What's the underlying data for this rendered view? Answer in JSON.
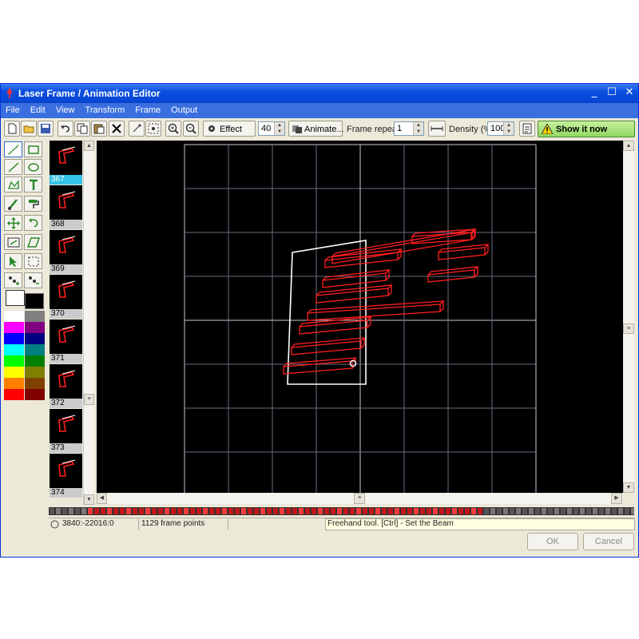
{
  "window": {
    "title": "Laser Frame / Animation Editor",
    "controls": [
      "_",
      "☐",
      "✕"
    ]
  },
  "menu": [
    "File",
    "Edit",
    "View",
    "Transform",
    "Frame",
    "Output"
  ],
  "toolbar": {
    "effect_label": "Effect",
    "effect_value": "40",
    "animate_label": "Animate...",
    "frame_repeats_label": "Frame repeats",
    "frame_repeats_value": "1",
    "density_label": "Density (%)",
    "density_value": "100",
    "show_now_label": "Show it now"
  },
  "frames": [
    {
      "number": "367",
      "selected": true
    },
    {
      "number": "368",
      "selected": false
    },
    {
      "number": "369",
      "selected": false
    },
    {
      "number": "370",
      "selected": false
    },
    {
      "number": "371",
      "selected": false
    },
    {
      "number": "372",
      "selected": false
    },
    {
      "number": "373",
      "selected": false
    },
    {
      "number": "374",
      "selected": false
    }
  ],
  "palette": [
    "#ffffff",
    "#808080",
    "#ff00ff",
    "#800080",
    "#0000ff",
    "#000080",
    "#00ffff",
    "#008080",
    "#00ff00",
    "#008000",
    "#ffff00",
    "#808000",
    "#ff8000",
    "#804000",
    "#ff0000",
    "#800000"
  ],
  "status": {
    "coords": "3840:-22016:0",
    "points": "1129 frame points",
    "hint": "Freehand tool. [Ctrl] - Set the Beam"
  },
  "buttons": {
    "ok": "OK",
    "cancel": "Cancel"
  },
  "colors": {
    "beam": "#ff1e1e",
    "outline": "#ffffff",
    "grid": "#6d6d85",
    "canvas_bg": "#000000"
  }
}
